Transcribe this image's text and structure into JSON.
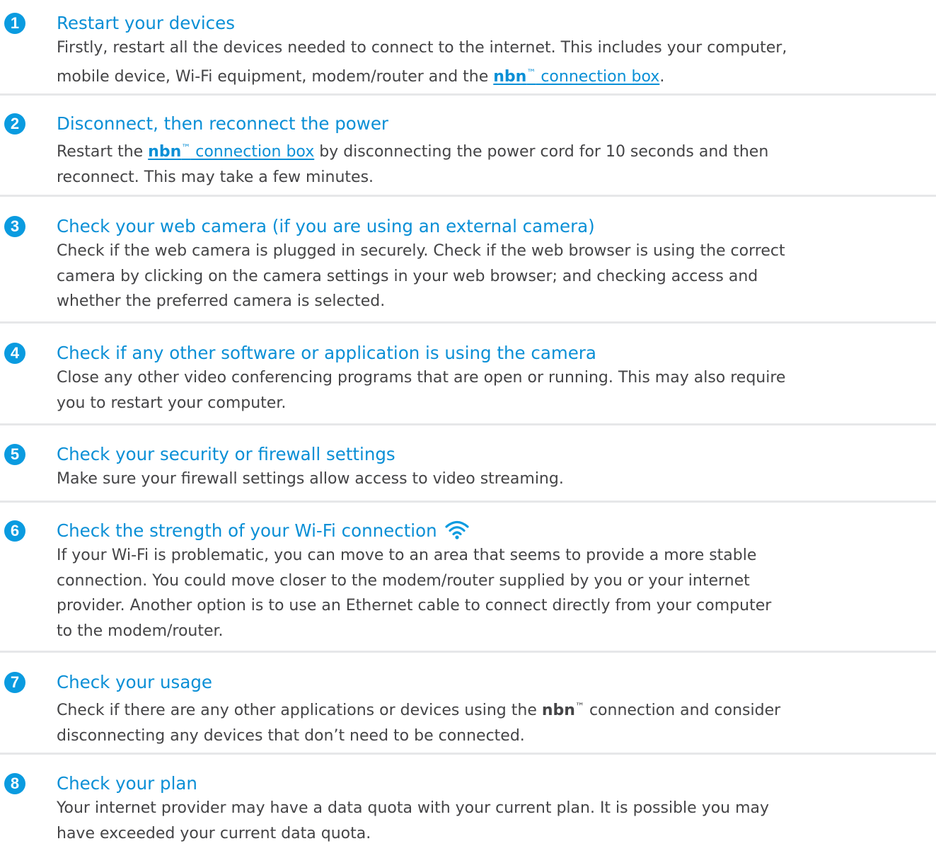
{
  "steps": [
    {
      "number": "1",
      "title": "Restart your devices",
      "lines": [
        "Firstly, restart all the devices needed to connect to the internet. This includes your computer,",
        "mobile device, Wi-Fi equipment, modem/router and the {brand_link}."
      ]
    },
    {
      "number": "2",
      "title": "Disconnect, then reconnect the power",
      "lines": [
        "Restart the {brand_link} by disconnecting the power cord for 10 seconds and then",
        "reconnect. This may take a few minutes."
      ]
    },
    {
      "number": "3",
      "title": "Check your web camera (if you are using an external camera)",
      "lines": [
        "Check if the web camera is plugged in securely. Check if the web browser is using the correct",
        "camera by clicking on the camera settings in your web browser; and checking access and",
        "whether the preferred camera is selected."
      ]
    },
    {
      "number": "4",
      "title": "Check if any other software or application is using the camera",
      "lines": [
        "Close any other video conferencing programs that are open or running. This may also require",
        "you to restart your computer."
      ]
    },
    {
      "number": "5",
      "title": "Check your security or firewall settings",
      "lines": [
        "Make sure your firewall settings allow access to video streaming."
      ]
    },
    {
      "number": "6",
      "title": "Check the strength of your Wi-Fi connection",
      "title_icon": "wifi-icon",
      "lines": [
        "If your Wi-Fi is problematic, you can move to an area that seems to provide a more stable",
        "connection. You could move closer to the modem/router supplied by you or your internet",
        "provider. Another option is to use an Ethernet cable to connect directly from your computer",
        "to the modem/router."
      ]
    },
    {
      "number": "7",
      "title": "Check your usage",
      "lines": [
        "Check if there are any other applications or devices using the {brand_plain} connection and consider",
        "disconnecting any devices that don’t need to be connected."
      ]
    },
    {
      "number": "8",
      "title": "Check your plan",
      "lines": [
        "Your internet provider may have a data quota with your current plan. It is possible you may",
        "have exceeded your current data quota."
      ]
    }
  ],
  "brand": {
    "name": "nbn",
    "trademark": "™",
    "link_text": " connection box"
  },
  "colors": {
    "accent": "#0a9be0",
    "title": "#0a8fd6",
    "body_text": "#444446",
    "divider": "#e6e7e9",
    "background": "#ffffff"
  }
}
